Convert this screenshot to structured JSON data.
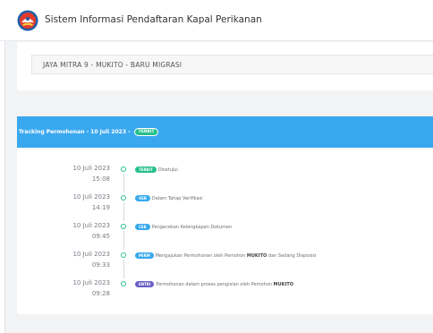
{
  "header": {
    "title": "Sistem Informasi Pendaftaran Kapal Perikanan",
    "logo_icon": "fisheries-emblem-icon"
  },
  "selection": {
    "value": "JAYA MITRA 9 - MUKITO - BARU MIGRASI"
  },
  "tracking": {
    "title": "Tracking Permohonan - 10 Juli 2023 -",
    "status_badge": "TERBIT",
    "status_color": "#27c08e",
    "header_color": "#3aa8ef",
    "items": [
      {
        "date": "10 Juli 2023",
        "time": "15:08",
        "badge": "TERBIT",
        "badge_color": "#27c08e",
        "text": "Disetujui"
      },
      {
        "date": "10 Juli 2023",
        "time": "14:19",
        "badge": "VER",
        "badge_color": "#38a9ee",
        "text": "Dalam Tahap Verifikasi"
      },
      {
        "date": "10 Juli 2023",
        "time": "09:45",
        "badge": "CEK",
        "badge_color": "#38a9ee",
        "text": "Pengecekan Kelengkapan Dokumen"
      },
      {
        "date": "10 Juli 2023",
        "time": "09:33",
        "badge": "PERM",
        "badge_color": "#38a9ee",
        "text_before": "Mengajukan Permohonan oleh Pemohon",
        "text_bold": "MUKITO",
        "text_after": "dan Sedang Disposisi"
      },
      {
        "date": "10 Juli 2023",
        "time": "09:28",
        "badge": "ENTRI",
        "badge_color": "#6c5fc7",
        "text_before": "Permohonan dalam proses pengisian oleh Pemohon",
        "text_bold": "MUKITO"
      }
    ]
  }
}
